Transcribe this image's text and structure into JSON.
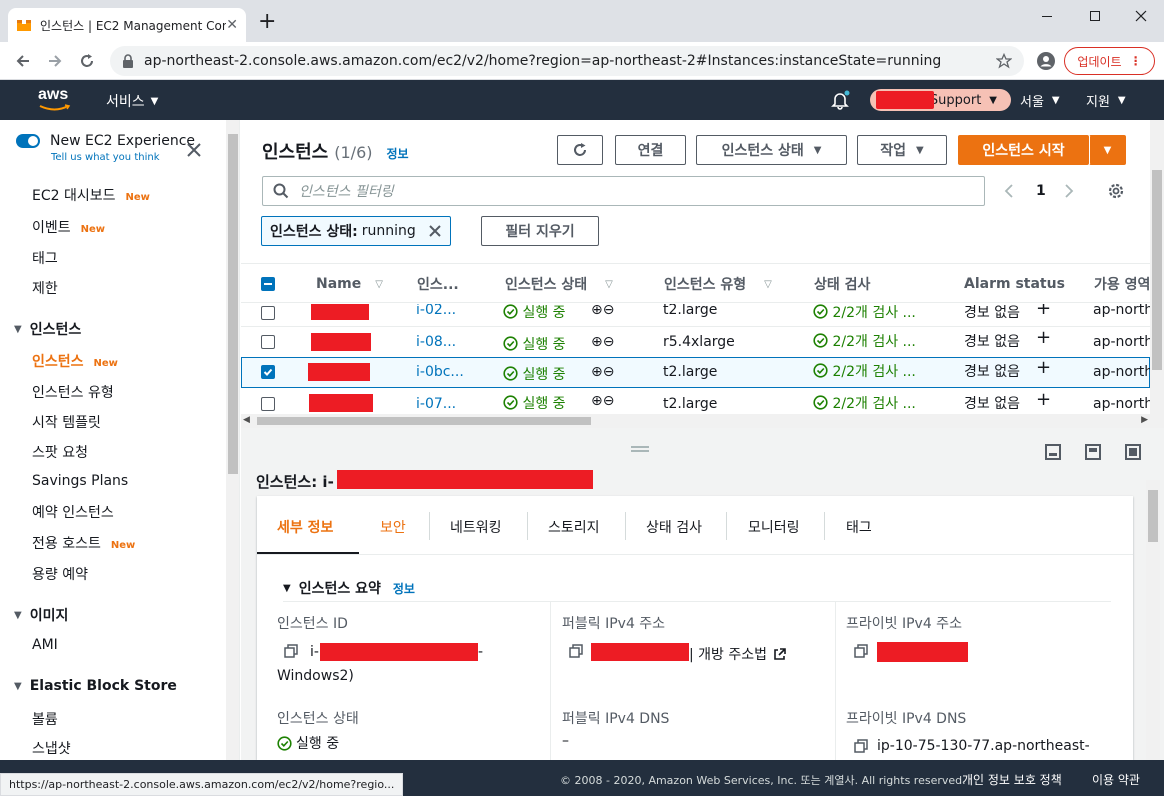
{
  "browser": {
    "tab_title": "인스턴스 | EC2 Management Con",
    "url": "ap-northeast-2.console.aws.amazon.com/ec2/v2/home?region=ap-northeast-2#Instances:instanceState=running",
    "update_label": "업데이트",
    "status_url": "https://ap-northeast-2.console.aws.amazon.com/ec2/v2/home?regio..."
  },
  "awsnav": {
    "logo": "aws",
    "services": "서비스",
    "support": "Support",
    "region": "서울",
    "help": "지원"
  },
  "sidebar": {
    "toggle_title": "New EC2 Experience",
    "toggle_sub": "Tell us what you think",
    "new_badge": "New",
    "items": [
      {
        "label": "EC2 대시보드",
        "new": true
      },
      {
        "label": "이벤트",
        "new": true
      },
      {
        "label": "태그"
      },
      {
        "label": "제한"
      }
    ],
    "group_instances": "인스턴스",
    "instance_items": [
      {
        "label": "인스턴스",
        "new": true,
        "active": true
      },
      {
        "label": "인스턴스 유형"
      },
      {
        "label": "시작 템플릿"
      },
      {
        "label": "스팟 요청"
      },
      {
        "label": "Savings Plans"
      },
      {
        "label": "예약 인스턴스"
      },
      {
        "label": "전용 호스트",
        "new": true
      },
      {
        "label": "용량 예약"
      }
    ],
    "group_images": "이미지",
    "image_items": [
      {
        "label": "AMI"
      }
    ],
    "group_ebs": "Elastic Block Store",
    "ebs_items": [
      {
        "label": "볼륨"
      },
      {
        "label": "스냅샷"
      }
    ]
  },
  "instances_panel": {
    "title": "인스턴스",
    "count": "(1/6)",
    "info": "정보",
    "connect": "연결",
    "state_btn": "인스턴스 상태",
    "actions_btn": "작업",
    "launch_btn": "인스턴스 시작",
    "filter_placeholder": "인스턴스 필터링",
    "page": "1",
    "chip_key": "인스턴스 상태:",
    "chip_value": "running",
    "clear_filters": "필터 지우기",
    "columns": [
      "Name",
      "인스...",
      "인스턴스 상태",
      "인스턴스 유형",
      "상태 검사",
      "Alarm status",
      "가용 영역"
    ],
    "rows": [
      {
        "id": "i-02...",
        "state": "실행 중",
        "type": "t2.large",
        "check": "2/2개 검사 ...",
        "alarm": "경보 없음",
        "az": "ap-north",
        "selected": false
      },
      {
        "id": "i-08...",
        "state": "실행 중",
        "type": "r5.4xlarge",
        "check": "2/2개 검사 ...",
        "alarm": "경보 없음",
        "az": "ap-north",
        "selected": false
      },
      {
        "id": "i-0bc...",
        "state": "실행 중",
        "type": "t2.large",
        "check": "2/2개 검사 ...",
        "alarm": "경보 없음",
        "az": "ap-north",
        "selected": true
      },
      {
        "id": "i-07...",
        "state": "실행 중",
        "type": "t2.large",
        "check": "2/2개 검사 ...",
        "alarm": "경보 없음",
        "az": "ap-north",
        "selected": false
      }
    ]
  },
  "detail": {
    "heading": "인스턴스: i-",
    "tabs": [
      "세부 정보",
      "보안",
      "네트워킹",
      "스토리지",
      "상태 검사",
      "모니터링",
      "태그"
    ],
    "summary_title": "인스턴스 요약",
    "summary_info": "정보",
    "instance_id_label": "인스턴스 ID",
    "instance_id_prefix": "i-",
    "instance_id_suffix": "-",
    "instance_id_line2": "Windows2)",
    "public_ipv4_label": "퍼블릭 IPv4 주소",
    "open_address": "| 개방 주소법",
    "private_ipv4_label": "프라이빗 IPv4 주소",
    "instance_state_label": "인스턴스 상태",
    "instance_state_value": "실행 중",
    "public_dns_label": "퍼블릭 IPv4 DNS",
    "public_dns_value": "–",
    "private_dns_label": "프라이빗 IPv4 DNS",
    "private_dns_value": "ip-10-75-130-77.ap-northeast-"
  },
  "footer": {
    "copyright": "© 2008 - 2020, Amazon Web Services, Inc. 또는 계열사. All rights reserved.",
    "privacy": "개인 정보 보호 정책",
    "terms": "이용 약관"
  },
  "colors": {
    "accent": "#ec7211",
    "nav": "#232f3e",
    "link": "#0073bb",
    "success": "#1d8102",
    "redact": "#ed1c24"
  }
}
